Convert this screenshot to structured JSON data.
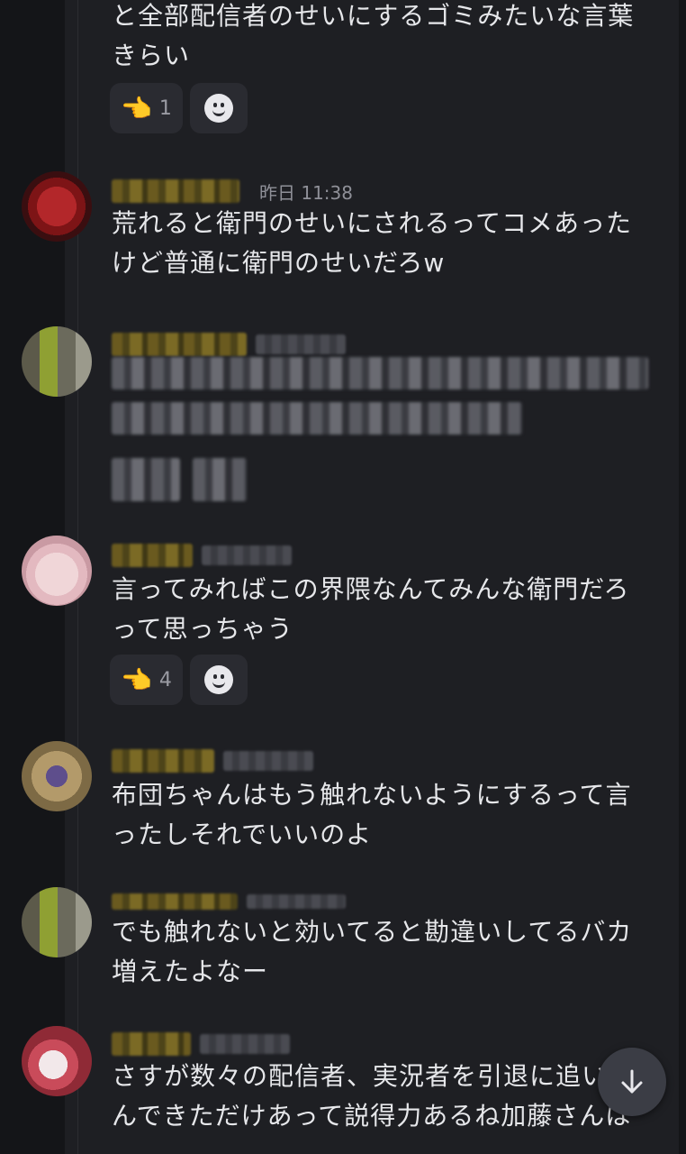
{
  "messages": [
    {
      "text": "と全部配信者のせいにするゴミみたいな言葉\nきらい",
      "reactions": [
        {
          "emoji": "👈",
          "count": "1"
        }
      ]
    },
    {
      "timestamp": "昨日 11:38",
      "text": "荒れると衛門のせいにされるってコメあった\nけど普通に衛門のせいだろw"
    },
    {
      "text": "言ってみればこの界隈なんてみんな衛門だろ\nって思っちゃう",
      "reactions": [
        {
          "emoji": "👈",
          "count": "4"
        }
      ]
    },
    {
      "text": "布団ちゃんはもう触れないようにするって言\nったしそれでいいのよ"
    },
    {
      "text": "でも触れないと効いてると勘違いしてるバカ\n増えたよなー"
    },
    {
      "text": "さすが数々の配信者、実況者を引退に追い込\nんできただけあって説得力あるね加藤さんは"
    }
  ],
  "icons": {
    "add_reaction": "smiley-add-reaction-icon",
    "scroll_down": "arrow-down-icon"
  },
  "colors": {
    "background": "#1e1f23",
    "text": "#e6e7ea",
    "muted": "#8f9098",
    "chip": "#2a2b31"
  }
}
